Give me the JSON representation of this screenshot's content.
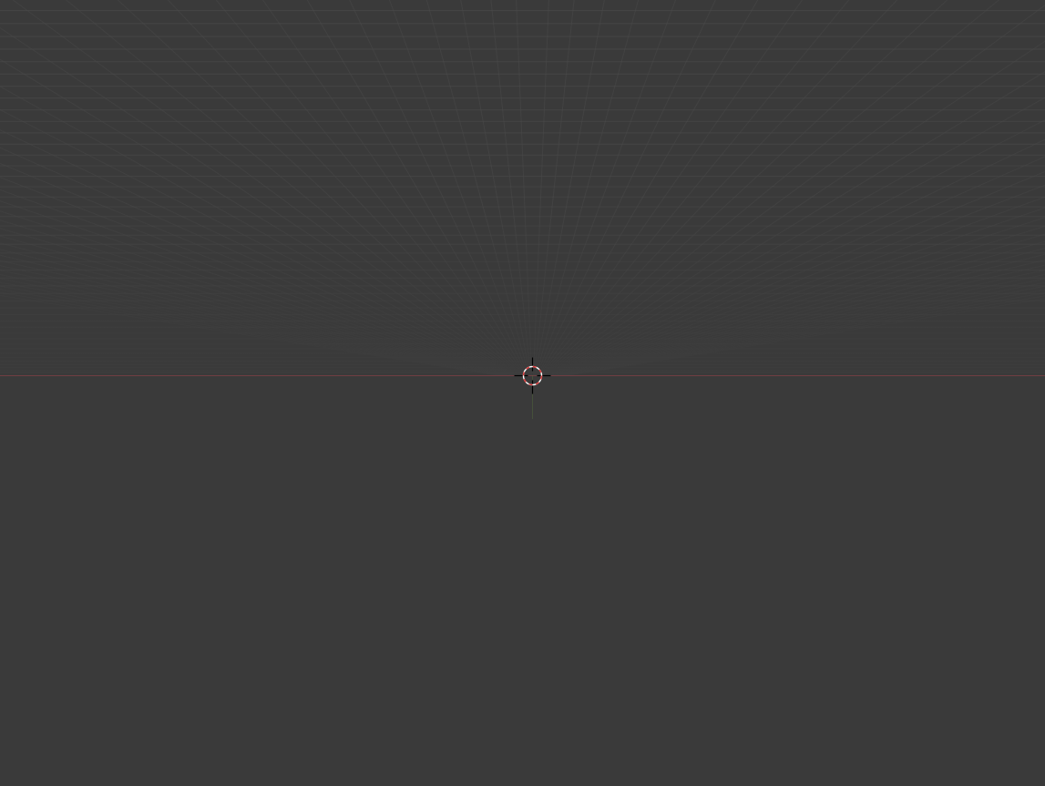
{
  "viewport": {
    "background_color": "#3a3a3a",
    "grid_line_color": "#4a4a4a",
    "grid_fade_color": "#3a3a3a",
    "x_axis_color": "#7a3f45",
    "y_axis_color": "#6b9a2e",
    "cursor_primary_color": "#ffffff",
    "cursor_secondary_color": "#e33b3b",
    "cursor_crosshair_color": "#000000",
    "cursor_icon": "3d-cursor-icon",
    "floor_grid": "visible",
    "view": "perspective"
  }
}
